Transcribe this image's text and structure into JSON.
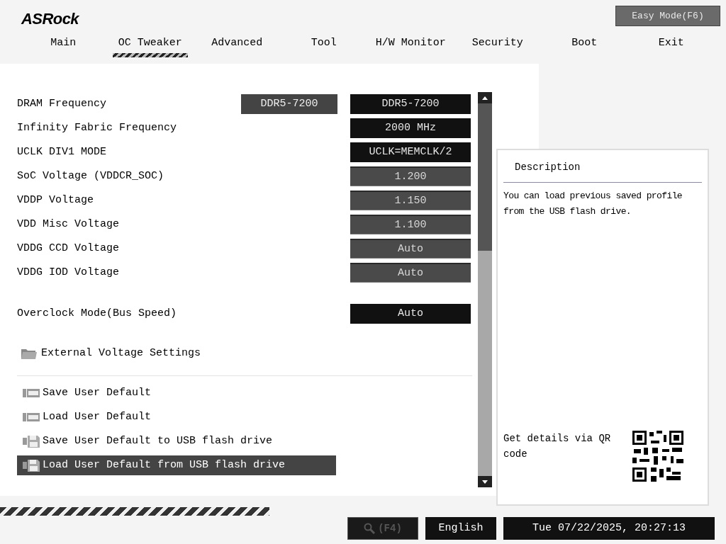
{
  "logo": "ASRock",
  "easy_mode_button": "Easy Mode(F6)",
  "tabs": [
    {
      "label": "Main",
      "selected": false
    },
    {
      "label": "OC Tweaker",
      "selected": true
    },
    {
      "label": "Advanced",
      "selected": false
    },
    {
      "label": "Tool",
      "selected": false
    },
    {
      "label": "H/W Monitor",
      "selected": false
    },
    {
      "label": "Security",
      "selected": false
    },
    {
      "label": "Boot",
      "selected": false
    },
    {
      "label": "Exit",
      "selected": false
    }
  ],
  "settings": [
    {
      "label": "DRAM Frequency",
      "current": "DDR5-7200",
      "value": "DDR5-7200",
      "kind": "option"
    },
    {
      "label": "Infinity Fabric Frequency",
      "value": "2000 MHz",
      "kind": "option"
    },
    {
      "label": "UCLK DIV1 MODE",
      "value": "UCLK=MEMCLK/2",
      "kind": "option"
    },
    {
      "label": "SoC Voltage (VDDCR_SOC)",
      "value": "1.200",
      "kind": "number"
    },
    {
      "label": "VDDP Voltage",
      "value": "1.150",
      "kind": "number"
    },
    {
      "label": "VDD Misc Voltage",
      "value": "1.100",
      "kind": "number"
    },
    {
      "label": "VDDG CCD Voltage",
      "value": "Auto",
      "kind": "number"
    },
    {
      "label": "VDDG IOD Voltage",
      "value": "Auto",
      "kind": "number"
    }
  ],
  "overclock_mode": {
    "label": "Overclock Mode(Bus Speed)",
    "value": "Auto"
  },
  "submenu": {
    "label": "External Voltage Settings"
  },
  "actions": [
    {
      "label": "Save User Default",
      "kind": "bios",
      "selected": false
    },
    {
      "label": "Load User Default",
      "kind": "bios",
      "selected": false
    },
    {
      "label": "Save User Default to USB flash drive",
      "kind": "usb",
      "selected": false
    },
    {
      "label": "Load User Default from USB flash drive",
      "kind": "usb",
      "selected": true
    }
  ],
  "description": {
    "title": "Description",
    "text": "You can load previous saved profile from the USB flash drive.",
    "qr_text": "Get details via QR code"
  },
  "footer": {
    "search": "(F4)",
    "language": "English",
    "datetime": "Tue 07/22/2025, 20:27:13"
  }
}
